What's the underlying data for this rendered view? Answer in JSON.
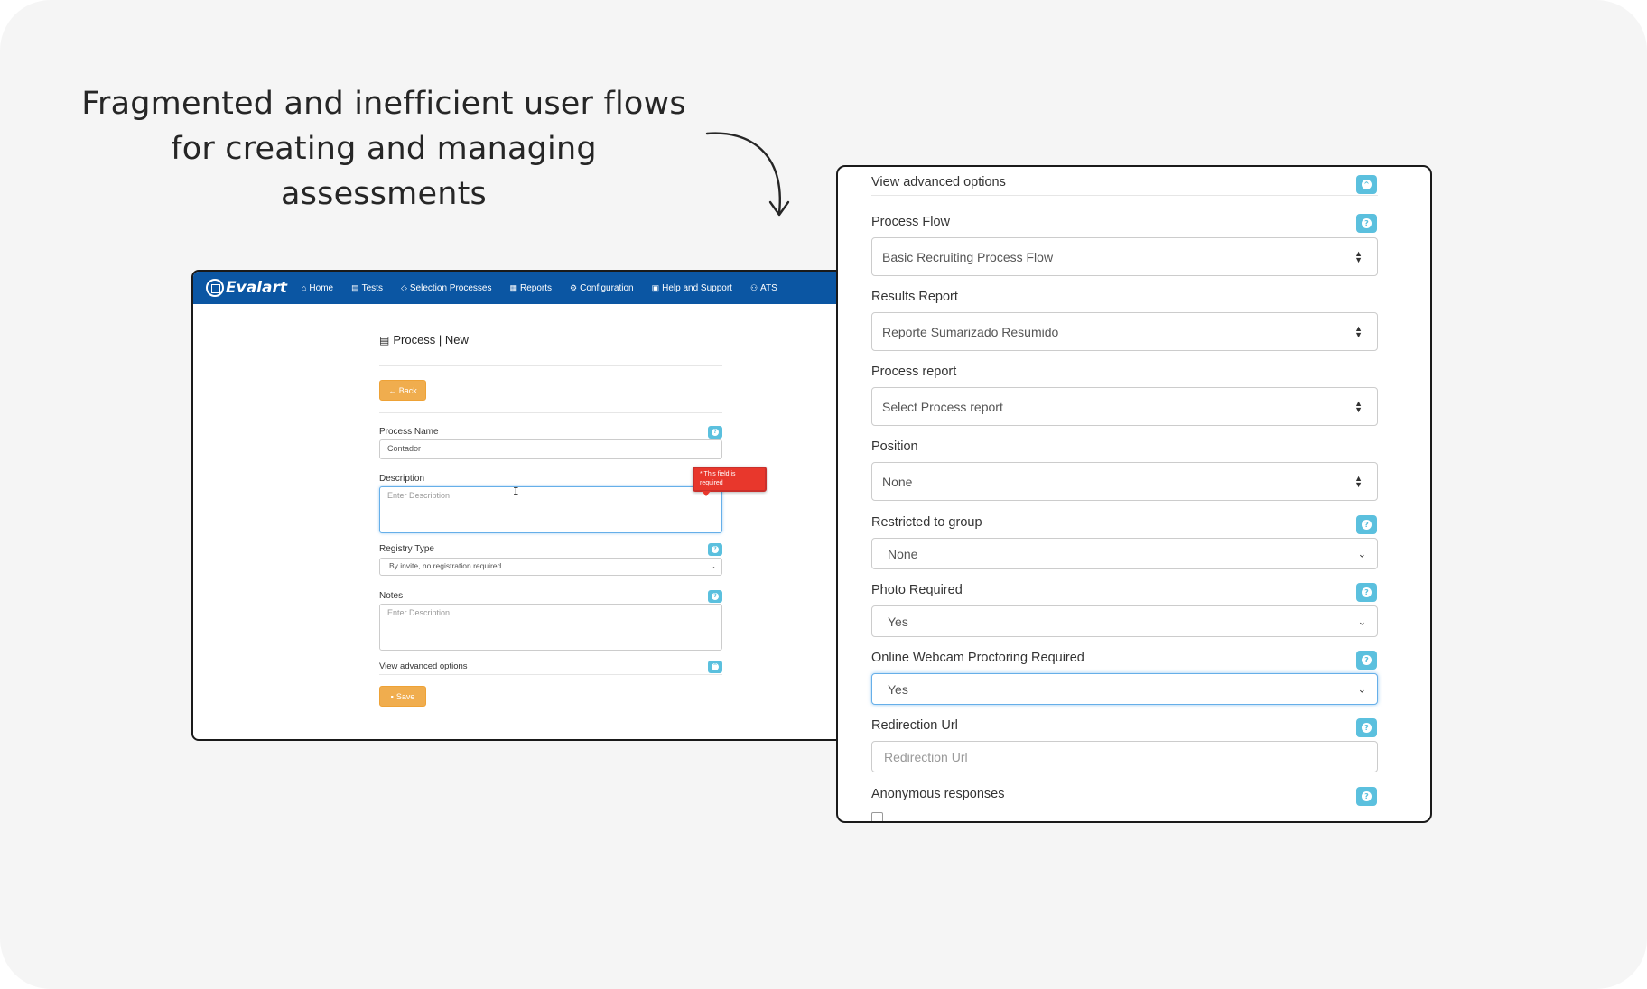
{
  "headline": "Fragmented and inefficient user flows for creating and managing assessments",
  "left_window": {
    "brand": "Evalart",
    "nav": [
      {
        "icon": "home-icon",
        "glyph": "⌂",
        "label": "Home"
      },
      {
        "icon": "tests-icon",
        "glyph": "▤",
        "label": "Tests"
      },
      {
        "icon": "diamond-icon",
        "glyph": "◇",
        "label": "Selection Processes"
      },
      {
        "icon": "reports-icon",
        "glyph": "▦",
        "label": "Reports"
      },
      {
        "icon": "gear-icon",
        "glyph": "⚙",
        "label": "Configuration"
      },
      {
        "icon": "briefcase-icon",
        "glyph": "▣",
        "label": "Help and Support"
      },
      {
        "icon": "ats-icon",
        "glyph": "⚇",
        "label": "ATS"
      }
    ],
    "page_title": "Process | New",
    "back_label": "← Back",
    "process_name_label": "Process Name",
    "process_name_value": "Contador",
    "description_label": "Description",
    "description_placeholder": "Enter Description",
    "tooltip_text": "* This field is required",
    "registry_type_label": "Registry Type",
    "registry_type_value": "By invite, no registration required",
    "notes_label": "Notes",
    "notes_placeholder": "Enter Description",
    "advanced_label": "View advanced options",
    "save_label": "Save",
    "help_glyph": "?"
  },
  "right_window": {
    "advanced_label": "View advanced options",
    "process_flow_label": "Process Flow",
    "process_flow_value": "Basic Recruiting Process Flow",
    "results_report_label": "Results Report",
    "results_report_value": "Reporte Sumarizado Resumido",
    "process_report_label": "Process report",
    "process_report_value": "Select Process report",
    "position_label": "Position",
    "position_value": "None",
    "restricted_label": "Restricted to group",
    "restricted_value": "None",
    "photo_label": "Photo Required",
    "photo_value": "Yes",
    "webcam_label": "Online Webcam Proctoring Required",
    "webcam_value": "Yes",
    "redirection_label": "Redirection Url",
    "redirection_placeholder": "Redirection Url",
    "anonymous_label": "Anonymous responses",
    "help_glyph": "?"
  },
  "colors": {
    "navbar": "#0b56a3",
    "accent_orange": "#f0ad4e",
    "help_badge": "#5bc0de",
    "error_red": "#e8372c",
    "background": "#f5f5f5"
  }
}
